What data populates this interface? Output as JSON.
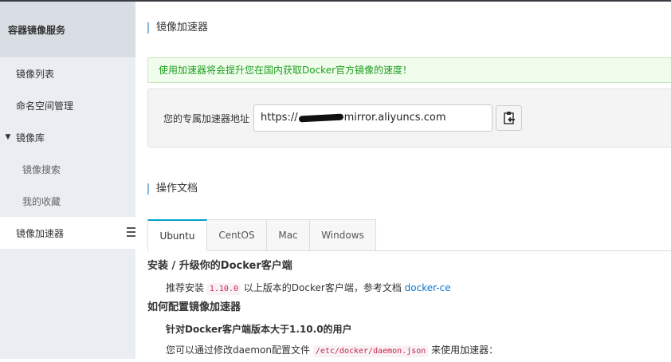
{
  "sidebar": {
    "title": "容器镜像服务",
    "items": [
      {
        "label": "镜像列表"
      },
      {
        "label": "命名空间管理"
      },
      {
        "label": "镜像库"
      },
      {
        "label": "镜像搜索"
      },
      {
        "label": "我的收藏"
      },
      {
        "label": "镜像加速器"
      }
    ]
  },
  "main": {
    "title": "镜像加速器",
    "alert": "使用加速器将会提升您在国内获取Docker官方镜像的速度！",
    "accelerator_label": "您的专属加速器地址",
    "url_prefix": "https://",
    "url_suffix": "mirror.aliyuncs.com",
    "docs_title": "操作文档",
    "tabs": [
      {
        "label": "Ubuntu"
      },
      {
        "label": "CentOS"
      },
      {
        "label": "Mac"
      },
      {
        "label": "Windows"
      }
    ],
    "doc": {
      "h1": "安装 / 升级你的Docker客户端",
      "p1_a": "推荐安装",
      "p1_code": "1.10.0",
      "p1_b": "以上版本的Docker客户端，参考文档",
      "p1_link": "docker-ce",
      "h2": "如何配置镜像加速器",
      "h3": "针对Docker客户端版本大于1.10.0的用户",
      "p2_a": "您可以通过修改daemon配置文件",
      "p2_code": "/etc/docker/daemon.json",
      "p2_b": "来使用加速器："
    }
  }
}
